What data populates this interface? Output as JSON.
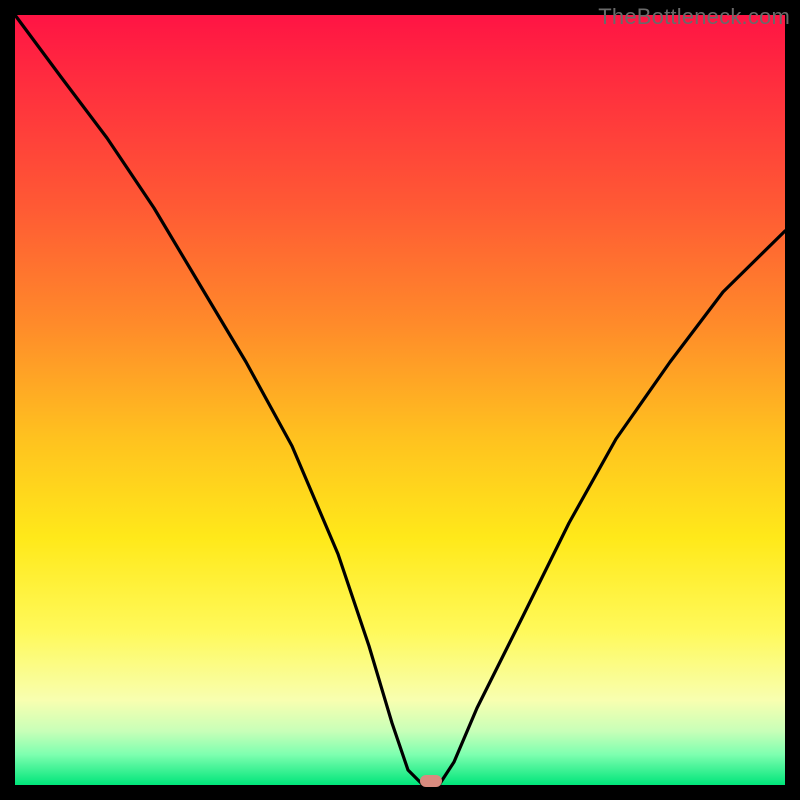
{
  "site": {
    "watermark": "TheBottleneck.com"
  },
  "chart_data": {
    "type": "line",
    "title": "",
    "xlabel": "",
    "ylabel": "",
    "xlim": [
      0,
      100
    ],
    "ylim": [
      0,
      100
    ],
    "grid": false,
    "legend": false,
    "background_gradient": {
      "direction": "vertical_top_to_bottom",
      "stops": [
        {
          "pos": 0.0,
          "color": "#ff1444"
        },
        {
          "pos": 0.25,
          "color": "#ff5a34"
        },
        {
          "pos": 0.55,
          "color": "#ffc21f"
        },
        {
          "pos": 0.8,
          "color": "#fff95a"
        },
        {
          "pos": 0.93,
          "color": "#c8ffb8"
        },
        {
          "pos": 1.0,
          "color": "#00e57a"
        }
      ]
    },
    "series": [
      {
        "name": "bottleneck-curve",
        "color": "#000000",
        "x": [
          0,
          6,
          12,
          18,
          24,
          30,
          36,
          42,
          46,
          49,
          51,
          53,
          55,
          57,
          60,
          66,
          72,
          78,
          85,
          92,
          100
        ],
        "y": [
          100,
          92,
          84,
          75,
          65,
          55,
          44,
          30,
          18,
          8,
          2,
          0,
          0,
          3,
          10,
          22,
          34,
          45,
          55,
          64,
          72
        ]
      }
    ],
    "annotations": [
      {
        "name": "minimum-marker",
        "type": "pill",
        "x": 54,
        "y": 0,
        "color": "#d98b7f"
      }
    ]
  }
}
